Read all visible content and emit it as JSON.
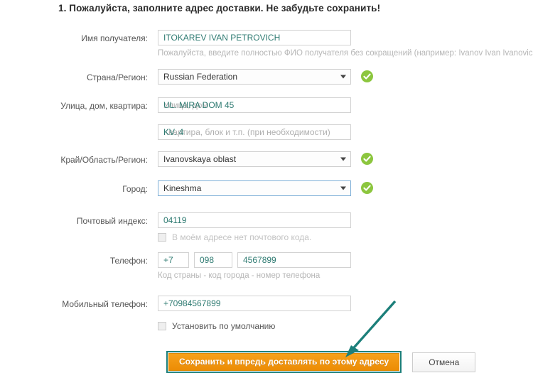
{
  "page": {
    "heading": "1. Пожалуйста, заполните адрес доставки. Не забудьте сохранить!"
  },
  "colors": {
    "input_text": "#2f7b72",
    "placeholder": "#b0b0b0",
    "label": "#555555",
    "hint": "#b6b6b6",
    "valid_badge": "#8cc63e",
    "save_button": "#ec8c05",
    "annotation": "#1c7f7a"
  },
  "form": {
    "recipient": {
      "label": "Имя получателя:",
      "value": "ITOKAREV IVAN PETROVICH",
      "hint": "Пожалуйста, введите полностью ФИО получателя без сокращений (например: Ivanov Ivan Ivanovich)."
    },
    "country": {
      "label": "Страна/Регион:",
      "value": "Russian Federation",
      "valid": true,
      "caret_icon": "chevron-down-icon"
    },
    "street": {
      "label": "Улица, дом, квартира:",
      "value": "UL. MIRA DOM 45",
      "placeholder": "Улица, дом"
    },
    "apartment": {
      "value": "KV. 4",
      "placeholder": "Квартира, блок и т.п. (при необходимости)"
    },
    "region": {
      "label": "Край/Область/Регион:",
      "value": "Ivanovskaya oblast",
      "valid": true,
      "caret_icon": "chevron-down-icon"
    },
    "city": {
      "label": "Город:",
      "value": "Kineshma",
      "valid": true,
      "caret_icon": "chevron-down-icon"
    },
    "postcode": {
      "label": "Почтовый индекс:",
      "value": "04119",
      "no_postcode_label": "В моём адресе нет почтового кода.",
      "no_postcode_checked": false
    },
    "phone": {
      "label": "Телефон:",
      "country_code": "+7",
      "area_code": "098",
      "number": "4567899",
      "hint": "Код страны - код города - номер телефона"
    },
    "mobile": {
      "label": "Мобильный телефон:",
      "value": "+70984567899"
    },
    "set_default": {
      "label": "Установить по умолчанию",
      "checked": false
    }
  },
  "buttons": {
    "save": "Сохранить и впредь доставлять по этому адресу",
    "cancel": "Отмена"
  },
  "annotation": {
    "arrow_icon": "arrow-pointing-down-left",
    "target": "save-button"
  }
}
